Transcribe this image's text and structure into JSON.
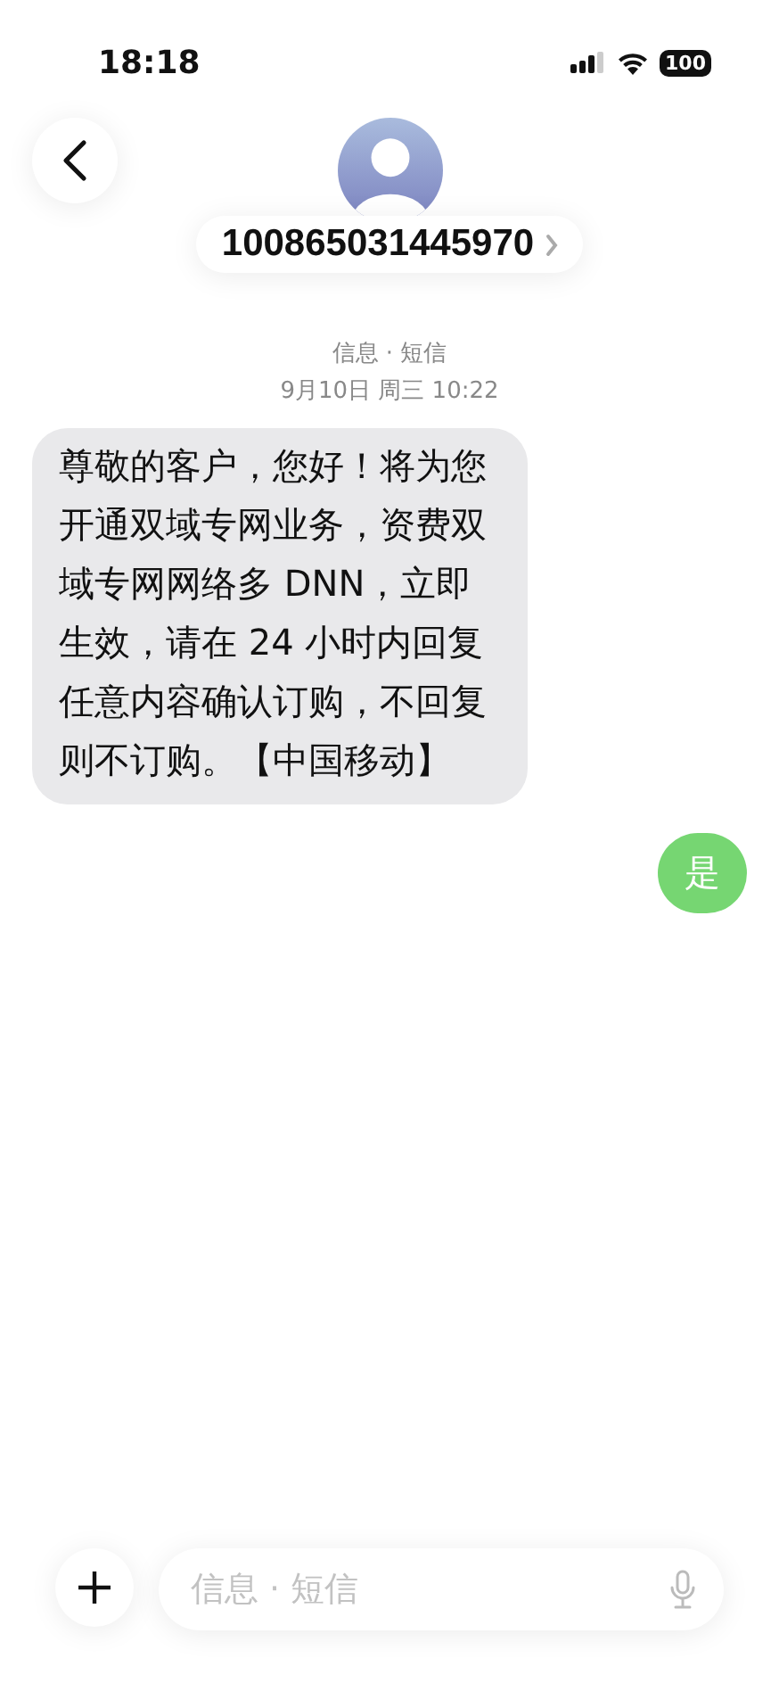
{
  "status_bar": {
    "time": "18:18",
    "battery": "100"
  },
  "header": {
    "contact": "100865031445970",
    "service": "信息 · 短信",
    "date": "9月10日 周三 10:22"
  },
  "messages": [
    {
      "kind": "incoming",
      "text": "尊敬的客户，您好！将为您开通双域专网业务，资费双域专网网络多 DNN，立即生效，请在 24 小时内回复任意内容确认订购，不回复则不订购。【中国移动】"
    },
    {
      "kind": "outgoing",
      "text": "是"
    }
  ],
  "composer": {
    "placeholder": "信息 · 短信"
  }
}
